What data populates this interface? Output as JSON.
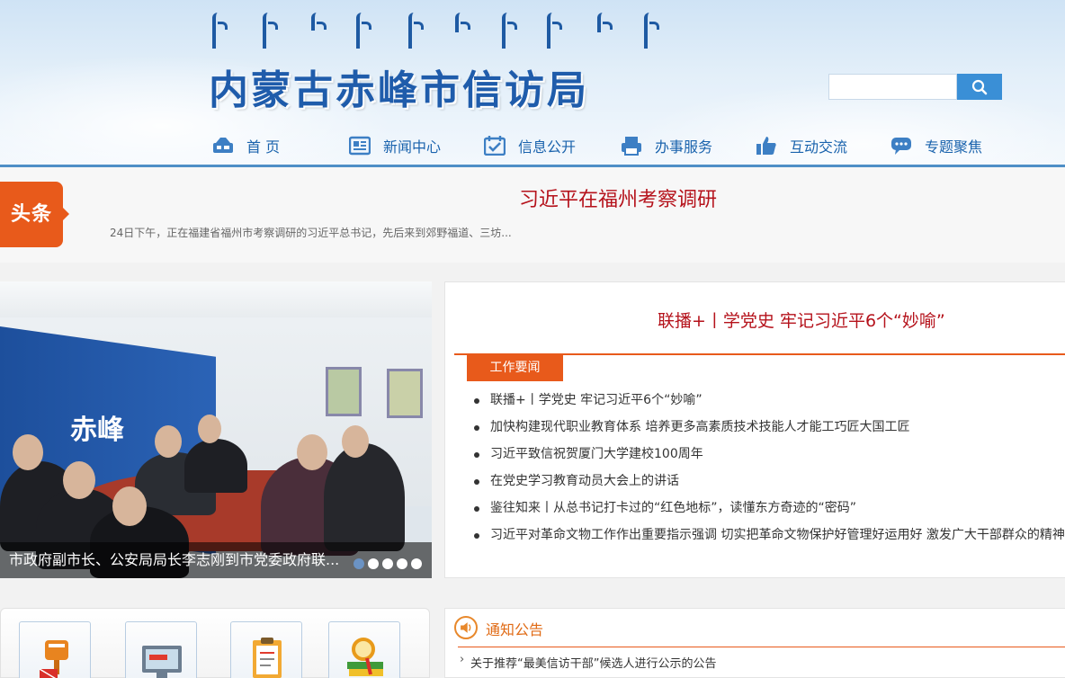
{
  "header": {
    "site_title": "内蒙古赤峰市信访局",
    "search": {
      "placeholder": ""
    }
  },
  "nav": {
    "items": [
      {
        "label": "首 页",
        "icon": "home-icon"
      },
      {
        "label": "新闻中心",
        "icon": "newspaper-icon"
      },
      {
        "label": "信息公开",
        "icon": "calendar-check-icon"
      },
      {
        "label": "办事服务",
        "icon": "printer-icon"
      },
      {
        "label": "互动交流",
        "icon": "thumbs-up-icon"
      },
      {
        "label": "专题聚焦",
        "icon": "chat-bubble-icon"
      }
    ]
  },
  "headline": {
    "tag": "头条",
    "title": "习近平在福州考察调研",
    "summary": "24日下午，正在福建省福州市考察调研的习近平总书记，先后来到郊野福道、三坊..."
  },
  "slider": {
    "wall_text": "赤峰",
    "caption": "市政府副市长、公安局局长李志刚到市党委政府联...",
    "dots": 5,
    "active_dot": 1
  },
  "news": {
    "headline": "联播+丨学党史 牢记习近平6个“妙喻”",
    "tab": "工作要闻",
    "items": [
      "联播+丨学党史 牢记习近平6个“妙喻”",
      "加快构建现代职业教育体系 培养更多高素质技术技能人才能工巧匠大国工匠",
      "习近平致信祝贺厦门大学建校100周年",
      "在党史学习教育动员大会上的讲话",
      "鉴往知来丨从总书记打卡过的“红色地标”，读懂东方奇迹的“密码”",
      "习近平对革命文物工作作出重要指示强调 切实把革命文物保护好管理好运用好 激发广大干部群众的精神"
    ]
  },
  "notice": {
    "title": "通知公告",
    "items": [
      "关于推荐“最美信访干部”候选人进行公示的公告"
    ]
  },
  "colors": {
    "brand_blue": "#1f5cab",
    "accent_orange": "#e85a1b",
    "headline_red": "#b5121b"
  }
}
